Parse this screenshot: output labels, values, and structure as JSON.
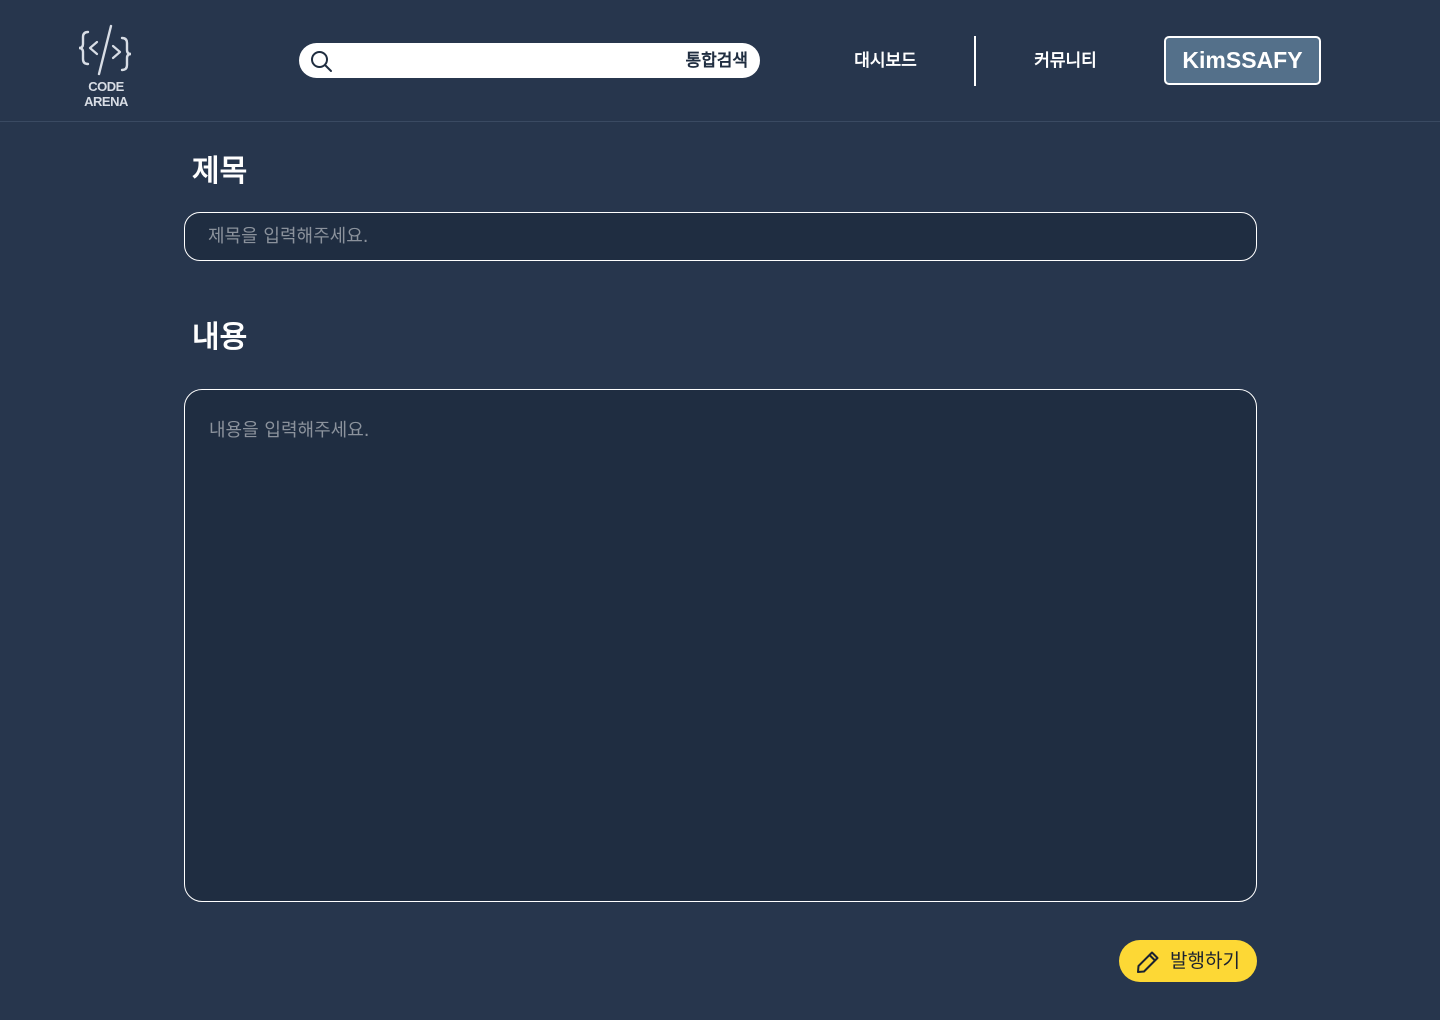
{
  "header": {
    "logo_text": "CODE ARENA",
    "search": {
      "placeholder": "",
      "button_label": "통합검색"
    },
    "nav": {
      "dashboard": "대시보드",
      "community": "커뮤니티"
    },
    "user": "KimSSAFY"
  },
  "form": {
    "title_label": "제목",
    "title_placeholder": "제목을 입력해주세요.",
    "content_label": "내용",
    "content_placeholder": "내용을 입력해주세요.",
    "publish_label": "발행하기"
  },
  "colors": {
    "background": "#27364d",
    "field_background": "#1f2d41",
    "accent_yellow": "#fdd835",
    "user_button": "#54708a"
  },
  "icons": {
    "logo": "code-brackets-icon",
    "search": "search-icon",
    "publish": "pencil-icon"
  }
}
